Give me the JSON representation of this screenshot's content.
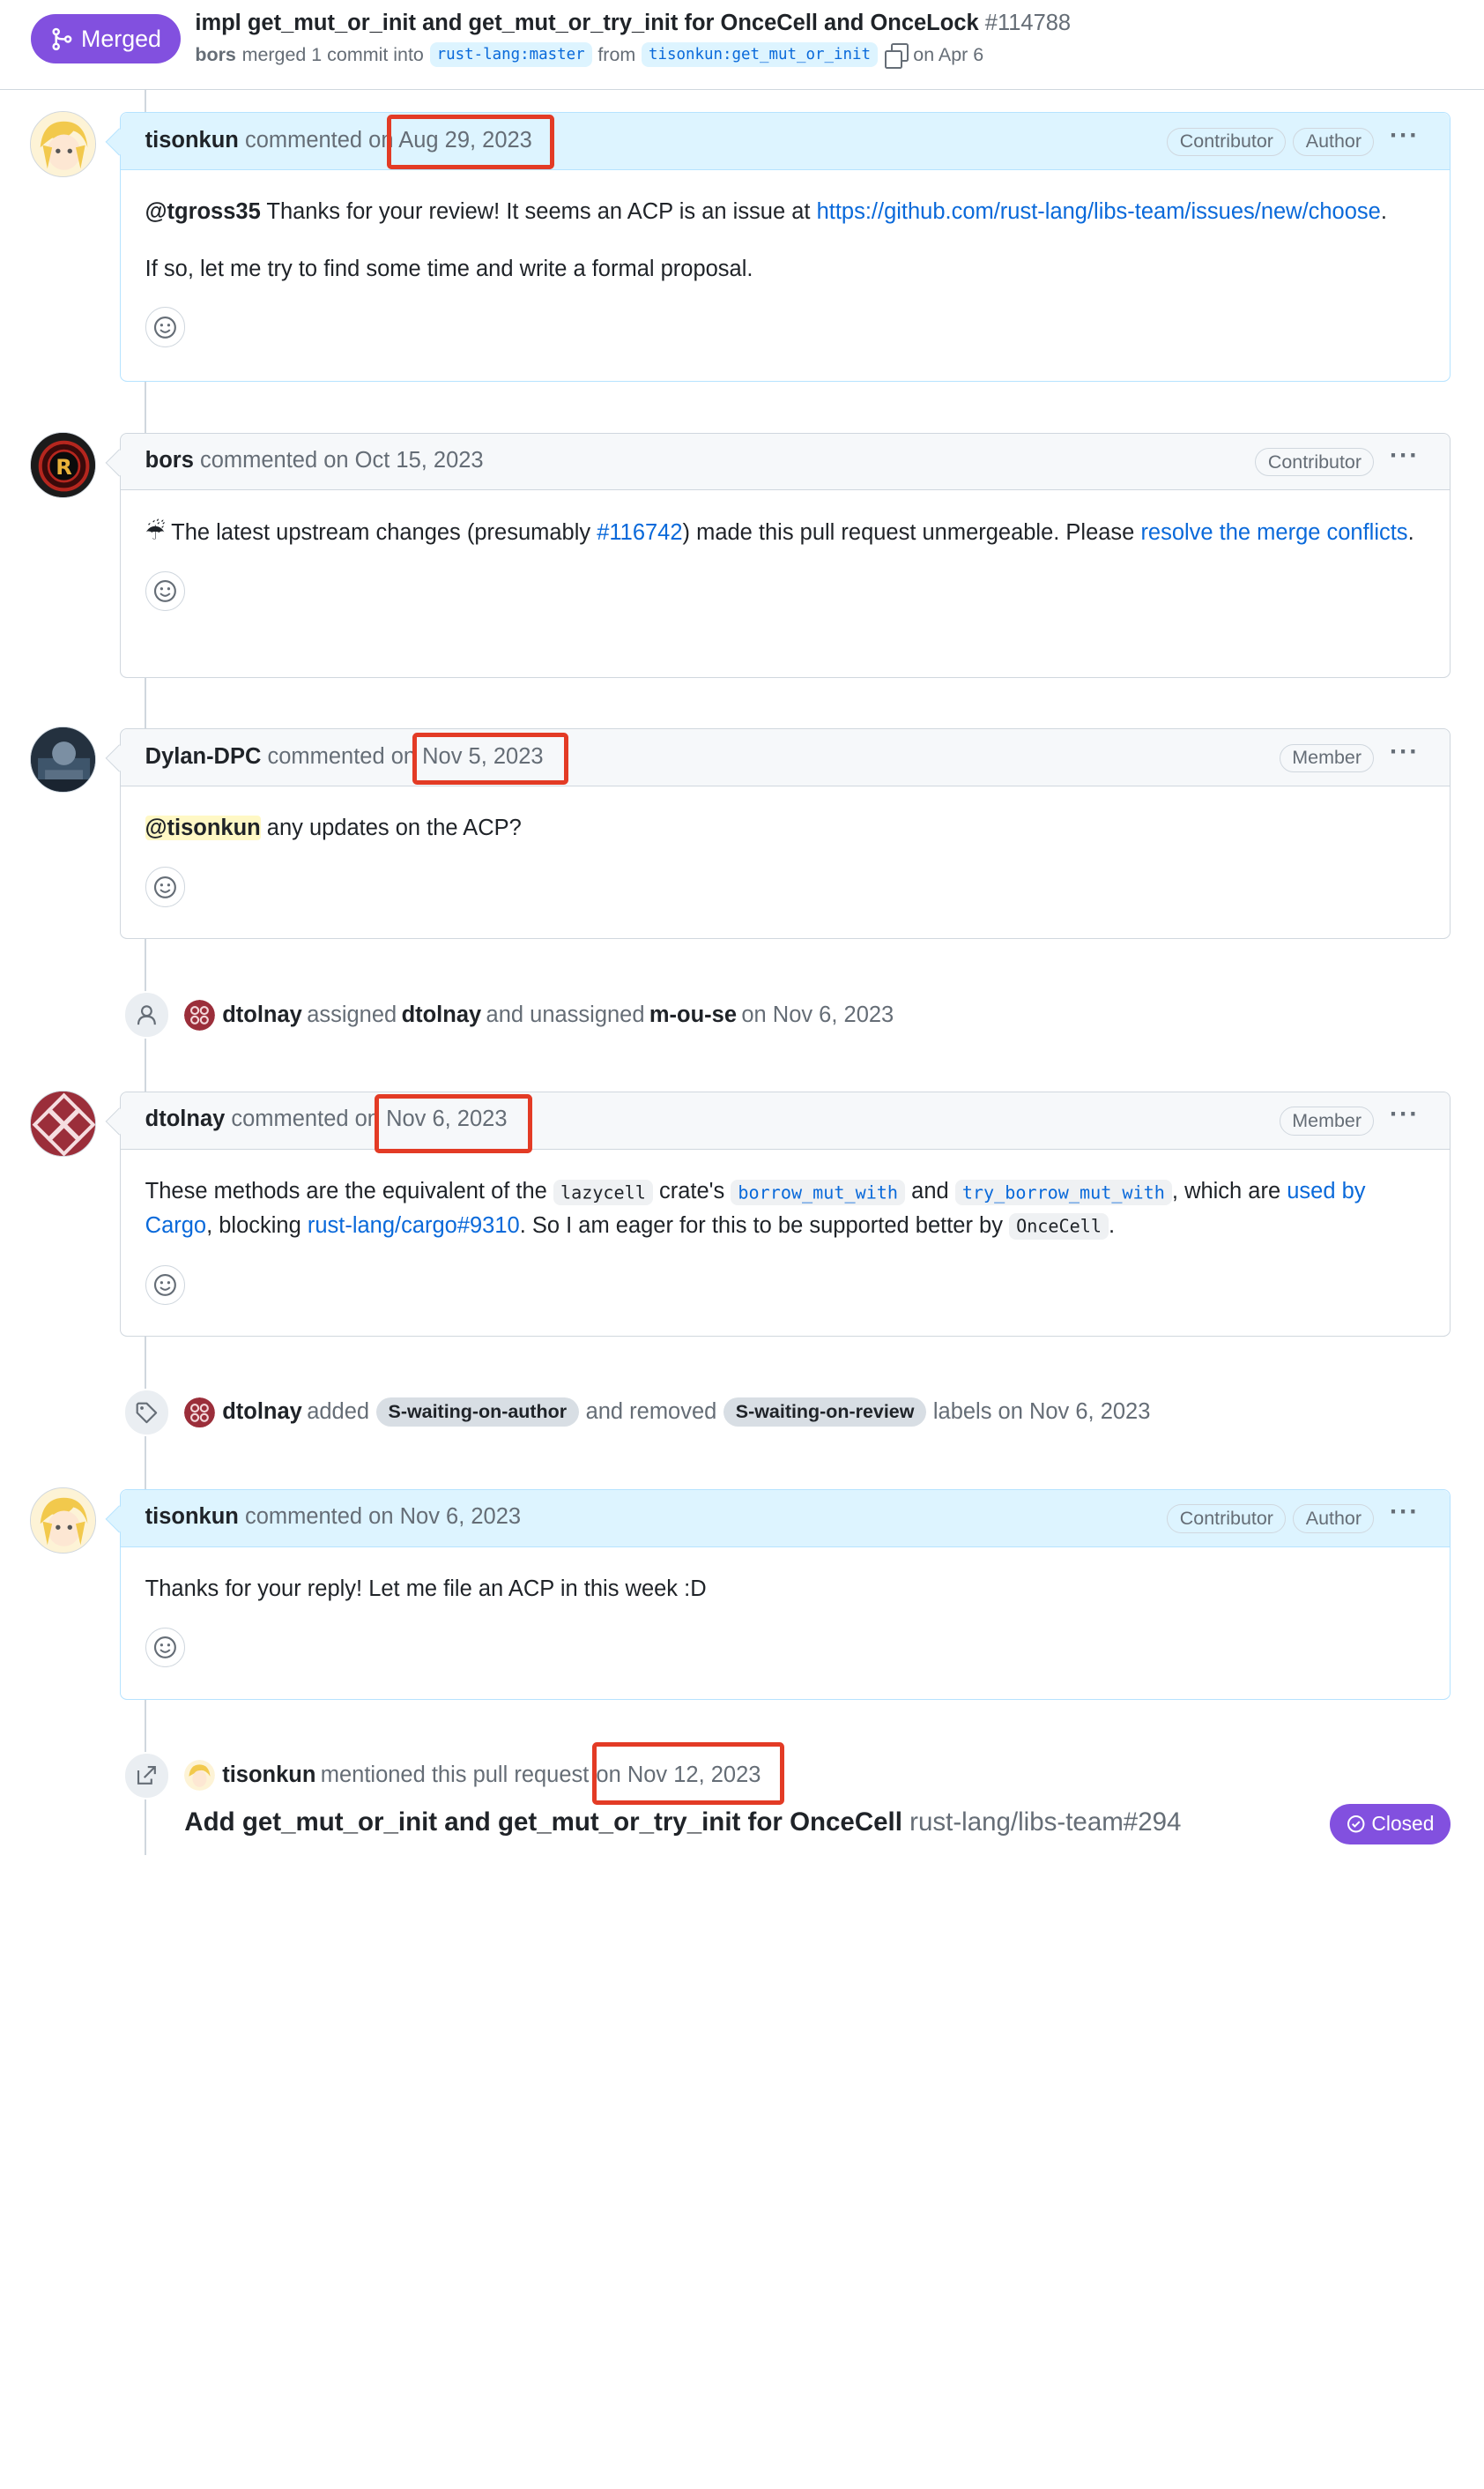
{
  "header": {
    "state_badge": "Merged",
    "title": "impl get_mut_or_init and get_mut_or_try_init for OnceCell and OnceLock",
    "number": "#114788",
    "merger": "bors",
    "merged_text": "merged 1 commit into",
    "base_branch": "rust-lang:master",
    "from_text": "from",
    "head_branch": "tisonkun:get_mut_or_init",
    "date": "on Apr 6"
  },
  "comments": [
    {
      "author": "tisonkun",
      "action": "commented on",
      "date": "Aug 29, 2023",
      "badges": [
        "Contributor",
        "Author"
      ],
      "body_mention": "@tgross35",
      "body_text1": "Thanks for your review! It seems an ACP is an issue at",
      "body_link": "https://github.com/rust-lang/libs-team/issues/new/choose",
      "body_end": ".",
      "body_p2": "If so, let me try to find some time and write a formal proposal."
    },
    {
      "author": "bors",
      "action": "commented on",
      "date": "Oct 15, 2023",
      "badges": [
        "Contributor"
      ],
      "emoji": "☔",
      "body_text1": "The latest upstream changes (presumably",
      "body_link1": "#116742",
      "body_text2": ") made this pull request unmergeable. Please",
      "body_link2": "resolve the merge conflicts",
      "body_end": "."
    },
    {
      "author": "Dylan-DPC",
      "action": "commented on",
      "date": "Nov 5, 2023",
      "badges": [
        "Member"
      ],
      "body_mention": "@tisonkun",
      "body_text1": "any updates on the ACP?"
    },
    {
      "author": "dtolnay",
      "action": "commented on",
      "date": "Nov 6, 2023",
      "badges": [
        "Member"
      ],
      "t1": "These methods are the equivalent of the",
      "c1": "lazycell",
      "t2": "crate's",
      "c2": "borrow_mut_with",
      "t3": "and",
      "c3": "try_borrow_mut_with",
      "t4": ", which are",
      "l1": "used by Cargo",
      "t5": ", blocking",
      "l2": "rust-lang/cargo#9310",
      "t6": ". So I am eager for this to be supported better by",
      "c4": "OnceCell",
      "t7": "."
    },
    {
      "author": "tisonkun",
      "action": "commented on",
      "date": "Nov 6, 2023",
      "badges": [
        "Contributor",
        "Author"
      ],
      "body_text1": "Thanks for your reply! Let me file an ACP in this week :D"
    }
  ],
  "events": {
    "assign": {
      "actor": "dtolnay",
      "t1": "assigned",
      "user1": "dtolnay",
      "t2": "and unassigned",
      "user2": "m-ou-se",
      "date": "on Nov 6, 2023"
    },
    "labels": {
      "actor": "dtolnay",
      "t1": "added",
      "label1": "S-waiting-on-author",
      "t2": "and removed",
      "label2": "S-waiting-on-review",
      "t3": "labels on Nov 6, 2023"
    },
    "mention": {
      "actor": "tisonkun",
      "t1": "mentioned this pull request",
      "date": "on Nov 12, 2023",
      "ref_title": "Add get_mut_or_init and get_mut_or_try_init for OnceCell",
      "ref_repo": "rust-lang/libs-team#294",
      "ref_state": "Closed"
    }
  },
  "colors": {
    "merged": "#8250df",
    "link": "#0969da",
    "highlight_box": "#e33b25"
  }
}
